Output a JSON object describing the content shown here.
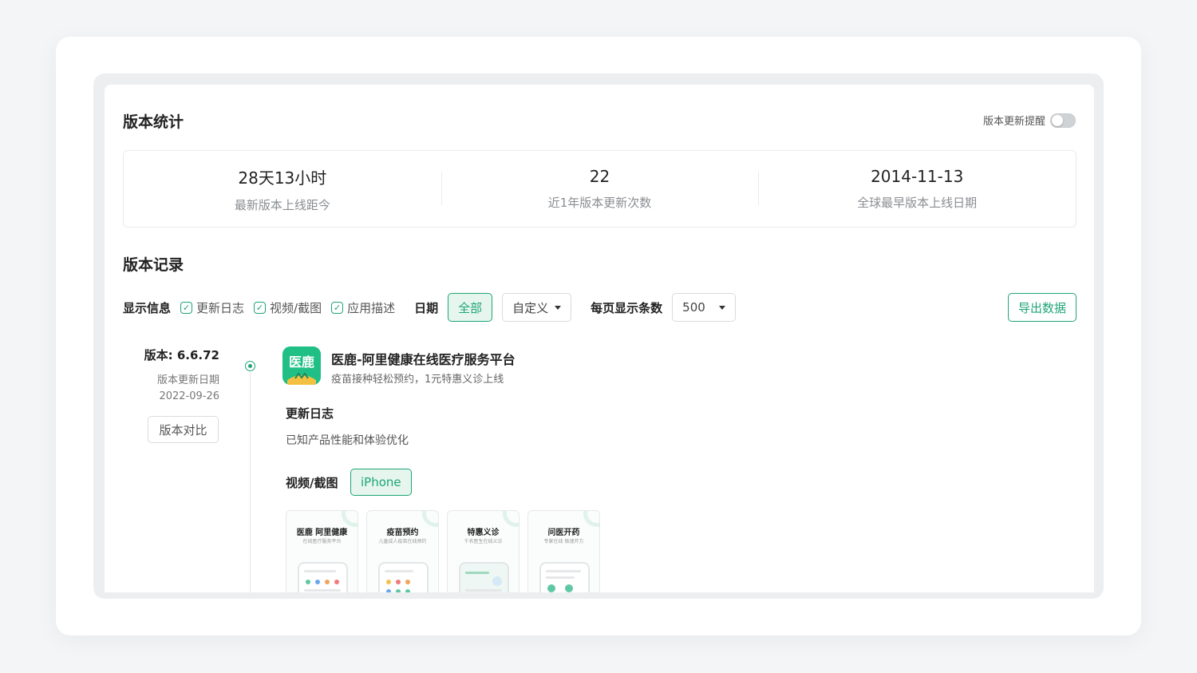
{
  "stats_section": {
    "title": "版本统计",
    "reminder_label": "版本更新提醒",
    "reminder_enabled": false,
    "stats": [
      {
        "value": "28天13小时",
        "label": "最新版本上线距今"
      },
      {
        "value": "22",
        "label": "近1年版本更新次数"
      },
      {
        "value": "2014-11-13",
        "label": "全球最早版本上线日期"
      }
    ]
  },
  "records_section": {
    "title": "版本记录",
    "filters": {
      "display_label": "显示信息",
      "options": [
        {
          "label": "更新日志",
          "checked": true
        },
        {
          "label": "视频/截图",
          "checked": true
        },
        {
          "label": "应用描述",
          "checked": true
        }
      ],
      "date_label": "日期",
      "date_all": "全部",
      "date_custom": "自定义",
      "per_page_label": "每页显示条数",
      "per_page_value": "500",
      "export_label": "导出数据"
    },
    "version": {
      "number": "版本: 6.6.72",
      "date_label": "版本更新日期",
      "date": "2022-09-26",
      "compare_label": "版本对比"
    },
    "app": {
      "icon_text": "医鹿",
      "name": "医鹿-阿里健康在线医疗服务平台",
      "subtitle": "疫苗接种轻松预约，1元特惠义诊上线",
      "log_heading": "更新日志",
      "log_text": "已知产品性能和体验优化",
      "media_heading": "视频/截图",
      "device_tag": "iPhone",
      "screenshots": [
        {
          "title": "医鹿 阿里健康",
          "subtitle": "在线医疗服务平台"
        },
        {
          "title": "疫苗预约",
          "subtitle": "儿童成人疫苗在线预约"
        },
        {
          "title": "特惠义诊",
          "subtitle": "千名医生在线义诊"
        },
        {
          "title": "问医开药",
          "subtitle": "专家在线 极速开方"
        }
      ]
    }
  },
  "colors": {
    "accent": "#1ea576",
    "accent_soft": "#e6f6ef",
    "icon_bg": "#1fbf86"
  }
}
